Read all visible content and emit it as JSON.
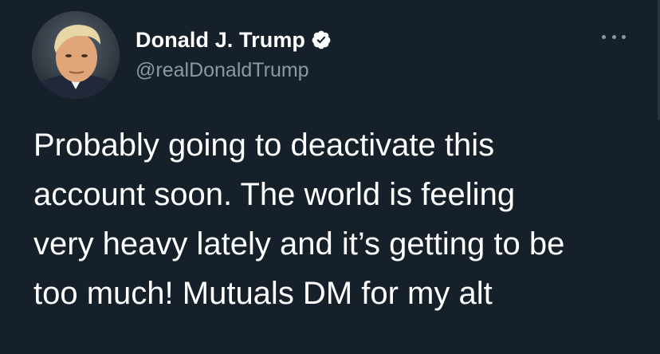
{
  "user": {
    "display_name": "Donald J. Trump",
    "handle": "@realDonaldTrump",
    "verified": true
  },
  "tweet": {
    "text": "Probably going to deactivate this\naccount soon. The world is feeling\nvery heavy lately and it’s getting to be\ntoo much! Mutuals DM for my alt"
  },
  "icons": {
    "verified": "verified-badge-icon",
    "more": "more-options-icon"
  },
  "colors": {
    "background": "#15202b",
    "primary_text": "#ffffff",
    "secondary_text": "#8b98a5"
  }
}
